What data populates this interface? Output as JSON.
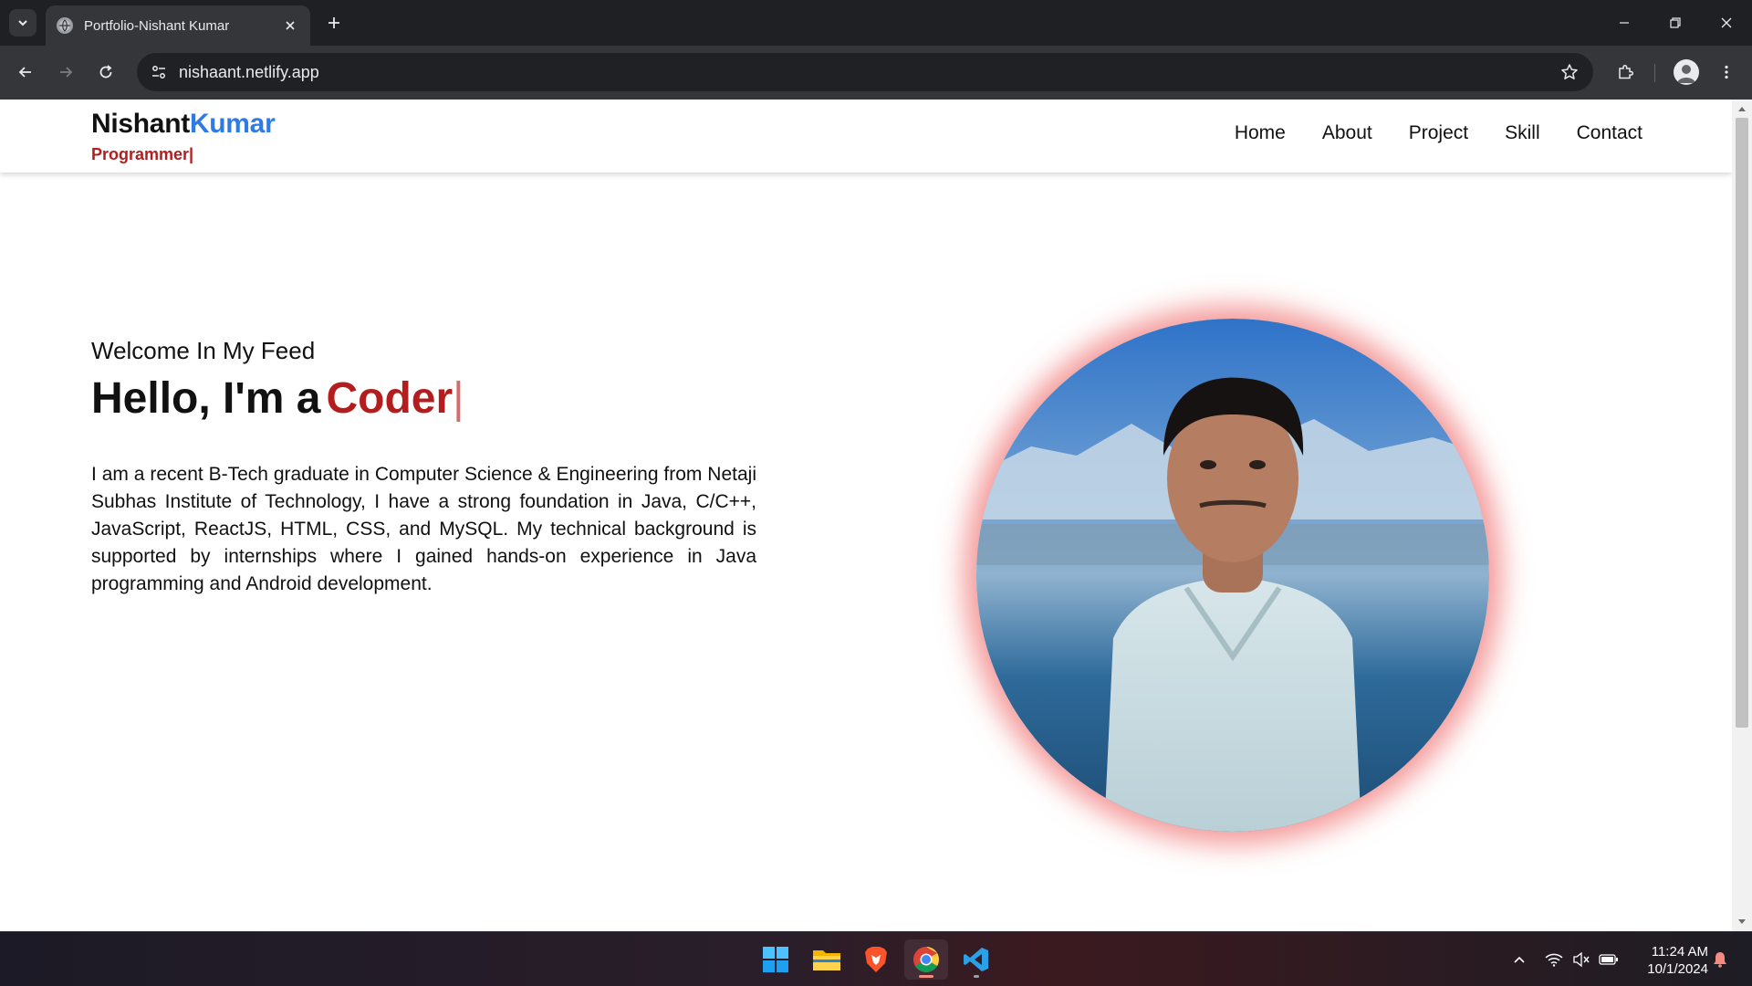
{
  "browser": {
    "tab_title": "Portfolio-Nishant Kumar",
    "url": "nishaant.netlify.app"
  },
  "site": {
    "logo_first": "Nishant",
    "logo_last": "Kumar",
    "logo_role": "Programmer",
    "role_caret": "|",
    "nav": [
      "Home",
      "About",
      "Project",
      "Skill",
      "Contact"
    ]
  },
  "hero": {
    "welcome": "Welcome In My Feed",
    "title_prefix": "Hello, I'm a",
    "title_accent": "Coder",
    "caret": "|",
    "description": "I am a recent B-Tech graduate in Computer Science & Engineering from Netaji Subhas Institute of Technology, I have a strong foundation in Java, C/C++, JavaScript, ReactJS, HTML, CSS, and MySQL. My technical background is supported by internships where I gained hands-on experience in Java programming and Android development."
  },
  "taskbar": {
    "time": "11:24 AM",
    "date": "10/1/2024"
  },
  "colors": {
    "accent_blue": "#2f7be6",
    "accent_red": "#b41d1d",
    "portrait_glow": "#eb4646"
  }
}
